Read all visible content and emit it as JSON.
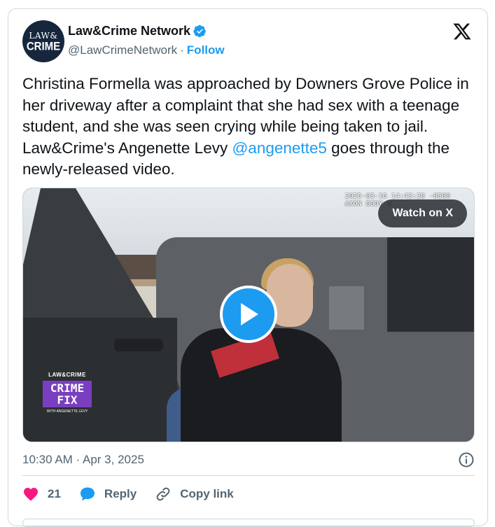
{
  "author": {
    "avatar_line1": "LAW&",
    "avatar_line2": "CRIME",
    "display_name": "Law&Crime Network",
    "handle": "@LawCrimeNetwork",
    "separator": "·",
    "follow_label": "Follow"
  },
  "tweet": {
    "text_before": "Christina Formella was approached by Downers Grove Police in her driveway after a complaint that she had sex with a teenage student, and she was seen crying while being taken to jail. Law&Crime's Angenette Levy ",
    "mention": "@angenette5",
    "text_after": " goes through the newly-released video."
  },
  "media": {
    "overlay_line1": "2025-03-16 14:43:28 -0500",
    "overlay_line2": "AXON BODY 3",
    "watch_label": "Watch on X",
    "badge_line1": "LAW&CRIME",
    "badge_line2": "CRIME FIX",
    "badge_line3": "WITH ANGENETTE LEVY"
  },
  "meta": {
    "timestamp": "10:30 AM · Apr 3, 2025"
  },
  "actions": {
    "like_count": "21",
    "reply_label": "Reply",
    "copy_label": "Copy link"
  },
  "colors": {
    "accent": "#1d9bf0",
    "like": "#f91880",
    "muted": "#536471"
  }
}
